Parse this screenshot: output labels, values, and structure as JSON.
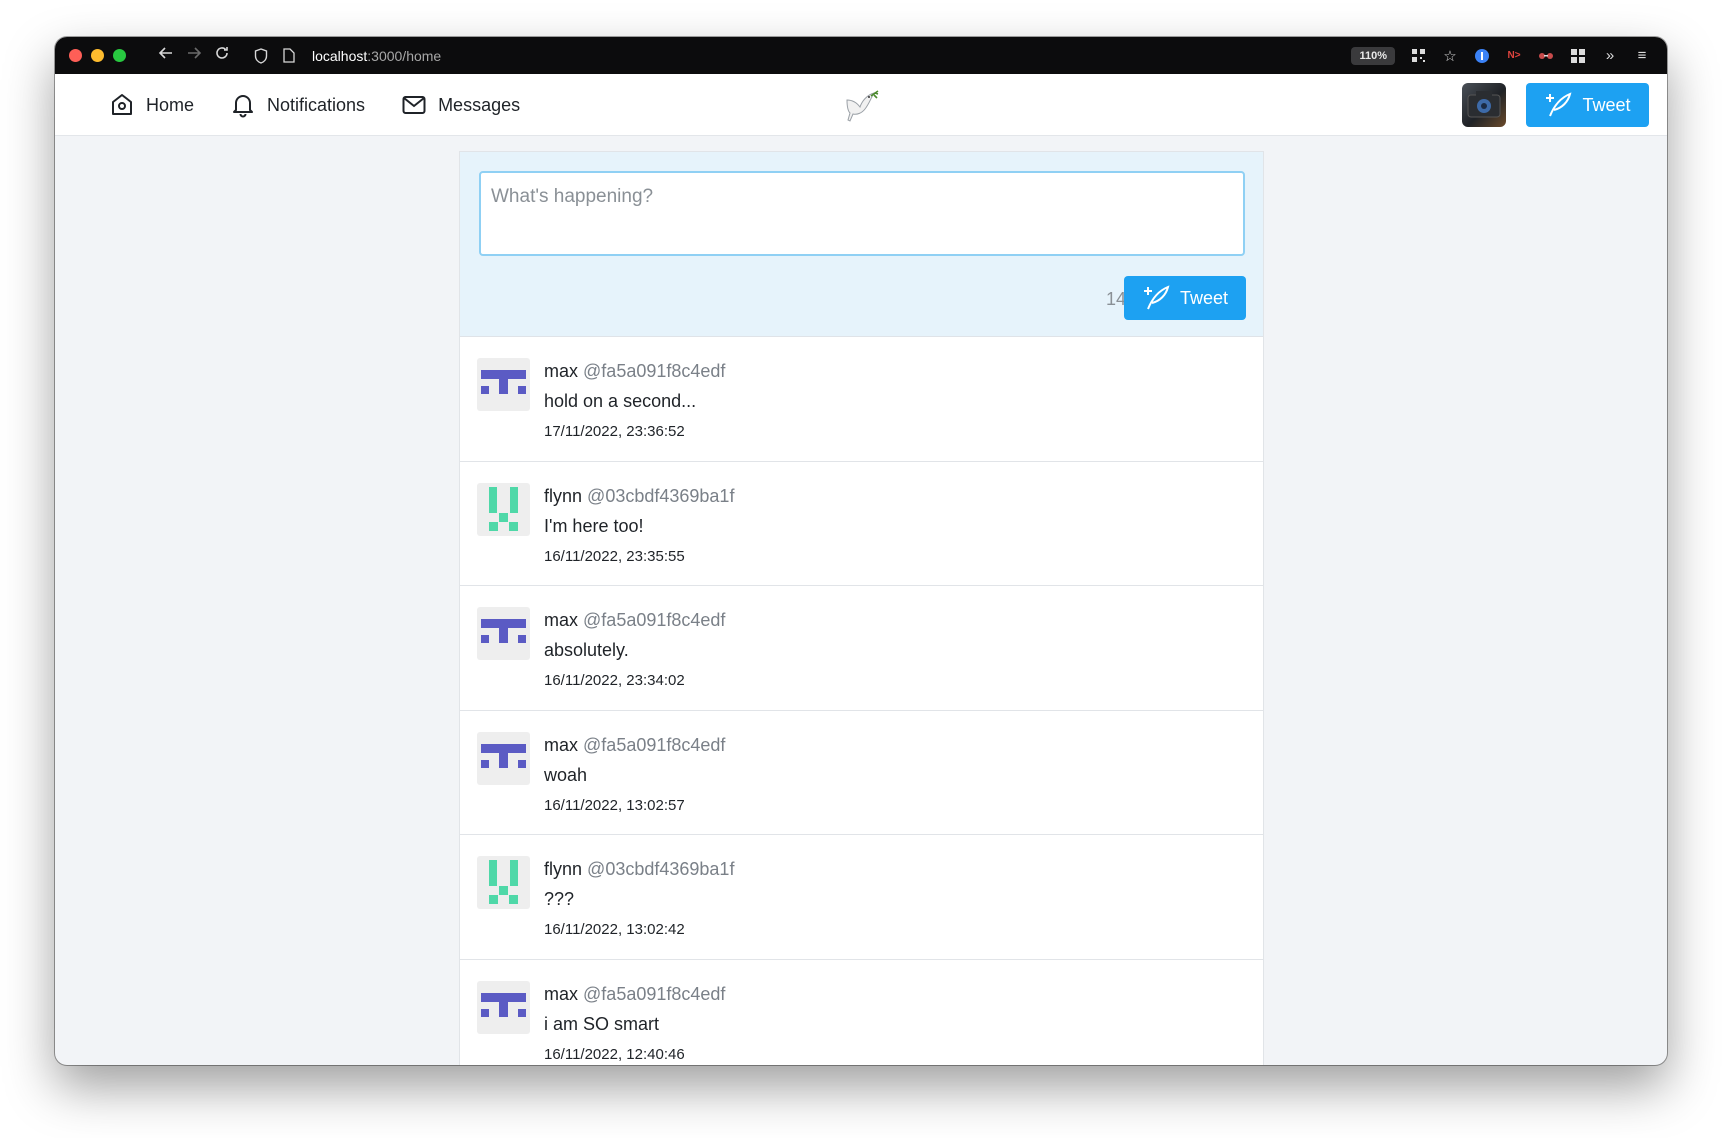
{
  "browser": {
    "url_host": "localhost",
    "url_path": ":3000/home",
    "zoom": "110%"
  },
  "nav": {
    "home": "Home",
    "notifications": "Notifications",
    "messages": "Messages",
    "tweet_button": "Tweet"
  },
  "composer": {
    "placeholder": "What's happening?",
    "char_count": "140",
    "tweet_button": "Tweet"
  },
  "colors": {
    "accent": "#1da1f2",
    "avatar_max": "#5b5bc4",
    "avatar_flynn": "#4fd8a8"
  },
  "tweets": [
    {
      "name": "max",
      "handle": "@fa5a091f8c4edf",
      "text": "hold on a second...",
      "time": "17/11/2022, 23:36:52",
      "avatar": "max"
    },
    {
      "name": "flynn",
      "handle": "@03cbdf4369ba1f",
      "text": "I'm here too!",
      "time": "16/11/2022, 23:35:55",
      "avatar": "flynn"
    },
    {
      "name": "max",
      "handle": "@fa5a091f8c4edf",
      "text": "absolutely.",
      "time": "16/11/2022, 23:34:02",
      "avatar": "max"
    },
    {
      "name": "max",
      "handle": "@fa5a091f8c4edf",
      "text": "woah",
      "time": "16/11/2022, 13:02:57",
      "avatar": "max"
    },
    {
      "name": "flynn",
      "handle": "@03cbdf4369ba1f",
      "text": "???",
      "time": "16/11/2022, 13:02:42",
      "avatar": "flynn"
    },
    {
      "name": "max",
      "handle": "@fa5a091f8c4edf",
      "text": "i am SO smart",
      "time": "16/11/2022, 12:40:46",
      "avatar": "max"
    }
  ]
}
